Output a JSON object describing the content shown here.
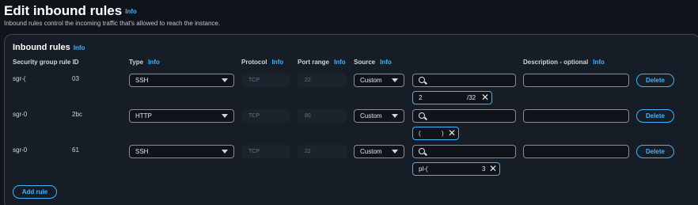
{
  "header": {
    "title": "Edit inbound rules",
    "info": "Info",
    "description": "Inbound rules control the incoming traffic that's allowed to reach the instance."
  },
  "panel": {
    "title": "Inbound rules",
    "info": "Info"
  },
  "columns": {
    "rule_id": "Security group rule ID",
    "type": "Type",
    "protocol": "Protocol",
    "port_range": "Port range",
    "source": "Source",
    "description": "Description - optional",
    "info": "Info"
  },
  "rules": [
    {
      "id_prefix": "sgr-(",
      "id_suffix": "03",
      "type": "SSH",
      "protocol": "TCP",
      "port": "22",
      "source": "Custom",
      "token_left": "2",
      "token_right": "/32",
      "delete": "Delete"
    },
    {
      "id_prefix": "sgr-0",
      "id_suffix": "2bc",
      "type": "HTTP",
      "protocol": "TCP",
      "port": "80",
      "source": "Custom",
      "token_left": "(",
      "token_right": ")",
      "delete": "Delete"
    },
    {
      "id_prefix": "sgr-0",
      "id_suffix": "61",
      "type": "SSH",
      "protocol": "TCP",
      "port": "22",
      "source": "Custom",
      "token_left": "pl-(",
      "token_right": "3",
      "delete": "Delete"
    }
  ],
  "add_rule": "Add rule",
  "icons": {
    "dropdown": "caret-down-icon",
    "search": "search-icon",
    "remove": "close-icon"
  },
  "colors": {
    "accent": "#42b4ff",
    "background": "#0f141a",
    "panel": "#161d26"
  }
}
